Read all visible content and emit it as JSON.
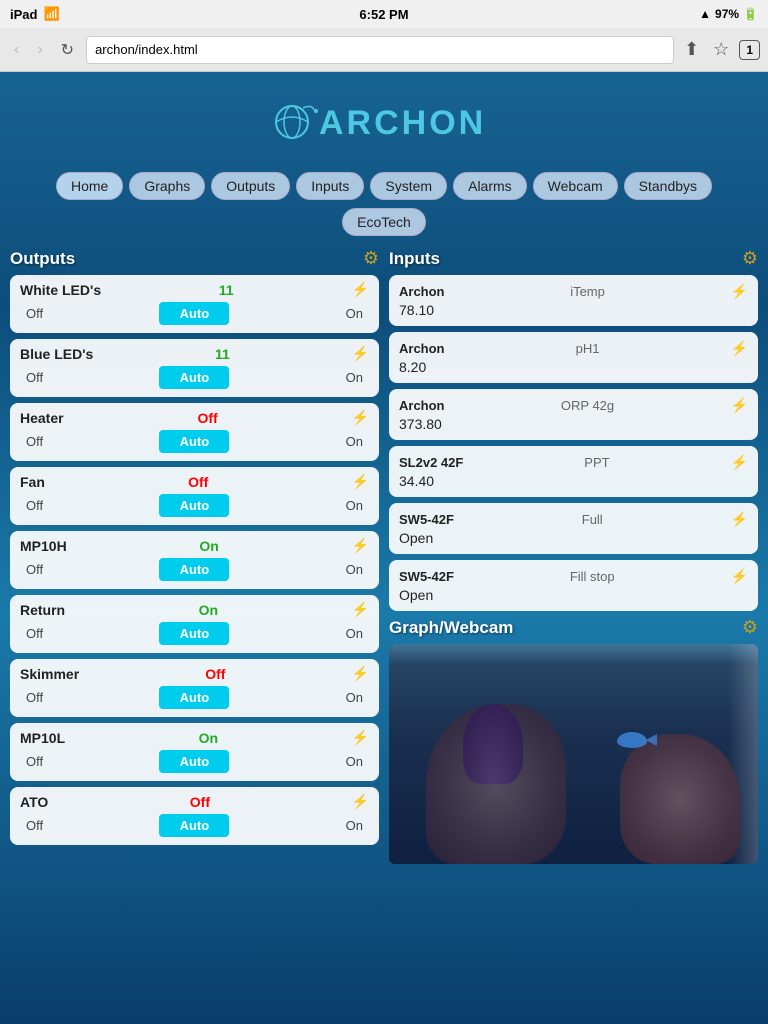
{
  "statusBar": {
    "carrier": "iPad",
    "wifi": "wifi",
    "time": "6:52 PM",
    "signal": "▲",
    "battery": "97%"
  },
  "browser": {
    "url": "archon/index.html",
    "backBtn": "‹",
    "forwardBtn": "›",
    "refreshBtn": "↻",
    "shareBtn": "⬆",
    "bookmarkBtn": "☆",
    "tabCount": "1"
  },
  "logo": {
    "text": "ARCHON"
  },
  "nav": {
    "items": [
      "Home",
      "Graphs",
      "Outputs",
      "Inputs",
      "System",
      "Alarms",
      "Webcam",
      "Standbys"
    ],
    "subItems": [
      "EcoTech"
    ]
  },
  "outputs": {
    "title": "Outputs",
    "items": [
      {
        "name": "White LED's",
        "status": "11",
        "statusType": "num",
        "controls": [
          "Off",
          "Auto",
          "On"
        ]
      },
      {
        "name": "Blue LED's",
        "status": "11",
        "statusType": "num",
        "controls": [
          "Off",
          "Auto",
          "On"
        ]
      },
      {
        "name": "Heater",
        "status": "Off",
        "statusType": "off",
        "controls": [
          "Off",
          "Auto",
          "On"
        ]
      },
      {
        "name": "Fan",
        "status": "Off",
        "statusType": "off",
        "controls": [
          "Off",
          "Auto",
          "On"
        ]
      },
      {
        "name": "MP10H",
        "status": "On",
        "statusType": "on",
        "controls": [
          "Off",
          "Auto",
          "On"
        ]
      },
      {
        "name": "Return",
        "status": "On",
        "statusType": "on",
        "controls": [
          "Off",
          "Auto",
          "On"
        ]
      },
      {
        "name": "Skimmer",
        "status": "Off",
        "statusType": "off",
        "controls": [
          "Off",
          "Auto",
          "On"
        ]
      },
      {
        "name": "MP10L",
        "status": "On",
        "statusType": "on",
        "controls": [
          "Off",
          "Auto",
          "On"
        ]
      },
      {
        "name": "ATO",
        "status": "Off",
        "statusType": "off",
        "controls": [
          "Off",
          "Auto",
          "On"
        ]
      }
    ]
  },
  "inputs": {
    "title": "Inputs",
    "items": [
      {
        "source": "Archon",
        "type": "iTemp",
        "value": "78.10"
      },
      {
        "source": "Archon",
        "type": "pH1",
        "value": "8.20"
      },
      {
        "source": "Archon",
        "type": "ORP 42g",
        "value": "373.80"
      },
      {
        "source": "SL2v2 42F",
        "type": "PPT",
        "value": "34.40"
      },
      {
        "source": "SW5-42F",
        "type": "Full",
        "value": "Open"
      },
      {
        "source": "SW5-42F",
        "type": "Fill stop",
        "value": "Open"
      }
    ]
  },
  "graphWebcam": {
    "title": "Graph/Webcam"
  },
  "colors": {
    "autoBtn": "#00ccee",
    "statusOff": "red",
    "statusOn": "#22aa22",
    "gearColor": "#c8a020"
  }
}
